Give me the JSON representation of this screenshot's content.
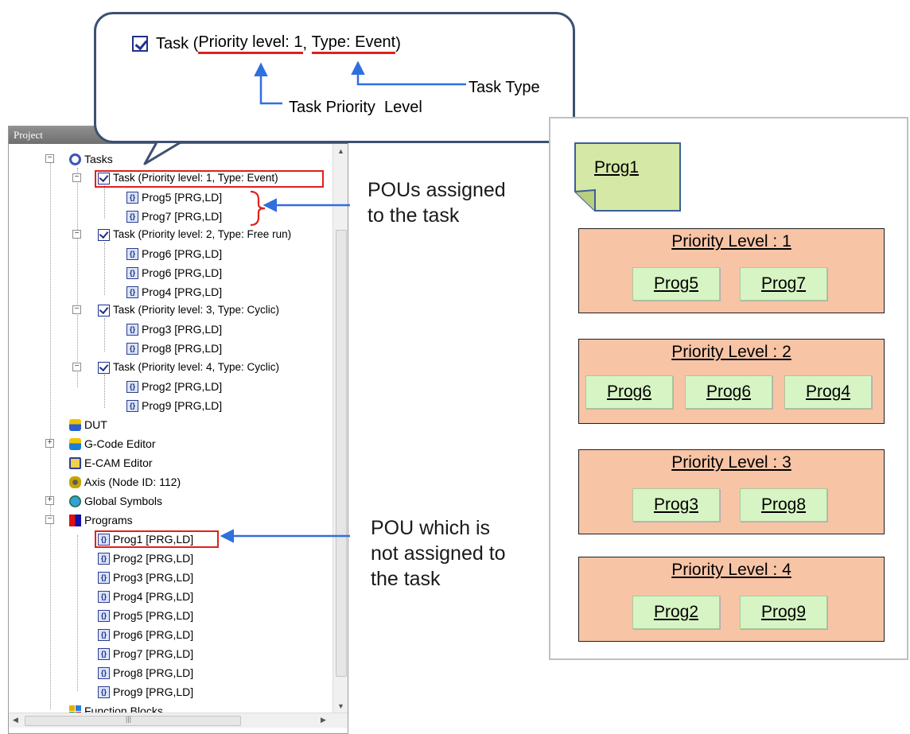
{
  "panel": {
    "title": "Project",
    "pin_glyph": "ᵒ",
    "close_glyph": "×",
    "scroll_mark": "|||",
    "tasks_label": "Tasks",
    "tasks": [
      {
        "label": "Task (Priority level: 1, Type: Event)",
        "programs": [
          "Prog5 [PRG,LD]",
          "Prog7 [PRG,LD]"
        ]
      },
      {
        "label": "Task (Priority level: 2, Type: Free run)",
        "programs": [
          "Prog6 [PRG,LD]",
          "Prog6 [PRG,LD]",
          "Prog4 [PRG,LD]"
        ]
      },
      {
        "label": "Task (Priority level: 3, Type: Cyclic)",
        "programs": [
          "Prog3 [PRG,LD]",
          "Prog8 [PRG,LD]"
        ]
      },
      {
        "label": "Task (Priority level: 4, Type: Cyclic)",
        "programs": [
          "Prog2 [PRG,LD]",
          "Prog9 [PRG,LD]"
        ]
      }
    ],
    "folders": [
      "DUT",
      "G-Code Editor",
      "E-CAM Editor",
      "Axis (Node ID: 112)",
      "Global Symbols"
    ],
    "programs_label": "Programs",
    "programs": [
      "Prog1 [PRG,LD]",
      "Prog2 [PRG,LD]",
      "Prog3 [PRG,LD]",
      "Prog4 [PRG,LD]",
      "Prog5 [PRG,LD]",
      "Prog6 [PRG,LD]",
      "Prog7 [PRG,LD]",
      "Prog8 [PRG,LD]",
      "Prog9 [PRG,LD]"
    ],
    "function_blocks_label": "Function Blocks",
    "icons": {
      "task": "checkbox-icon",
      "program": "program-icon",
      "tasks_folder": "gear-icon"
    }
  },
  "callout": {
    "prefix": "Task (",
    "priority_part": "Priority level: 1",
    "separator": ", ",
    "type_part": "Type: Event",
    "suffix": ")",
    "task_type_label": "Task Type",
    "task_priority_label": "Task Priority  Level"
  },
  "annotations": {
    "assigned_line1": "POUs assigned",
    "assigned_line2": "to the task",
    "unassigned_line1": "POU which is",
    "unassigned_line2": "not assigned to",
    "unassigned_line3": "the task"
  },
  "diagram": {
    "unassigned_note": "Prog1",
    "levels": [
      {
        "title": "Priority Level : 1",
        "programs": [
          "Prog5",
          "Prog7"
        ]
      },
      {
        "title": "Priority Level : 2",
        "programs": [
          "Prog6",
          "Prog6",
          "Prog4"
        ]
      },
      {
        "title": "Priority Level : 3",
        "programs": [
          "Prog3",
          "Prog8"
        ]
      },
      {
        "title": "Priority Level : 4",
        "programs": [
          "Prog2",
          "Prog9"
        ]
      }
    ]
  },
  "colors": {
    "highlight_red": "#e0201c",
    "arrow_blue": "#2f6fe0",
    "callout_border": "#3c5071",
    "priority_box_fill": "#f8c4a6",
    "program_chip_fill": "#d7f5c4",
    "note_fill": "#d6e8a6"
  }
}
